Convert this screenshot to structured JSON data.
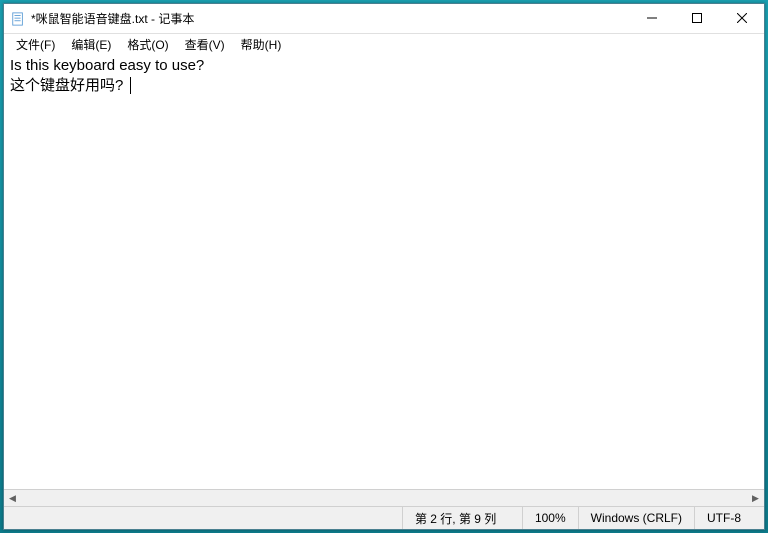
{
  "titlebar": {
    "title": "*咪鼠智能语音键盘.txt - 记事本"
  },
  "menu": {
    "file": "文件(F)",
    "edit": "编辑(E)",
    "format": "格式(O)",
    "view": "查看(V)",
    "help": "帮助(H)"
  },
  "content": {
    "line1": "Is this keyboard easy to use?",
    "line2": "这个键盘好用吗? "
  },
  "statusbar": {
    "position": "第 2 行, 第 9 列",
    "zoom": "100%",
    "eol": "Windows (CRLF)",
    "encoding": "UTF-8"
  }
}
